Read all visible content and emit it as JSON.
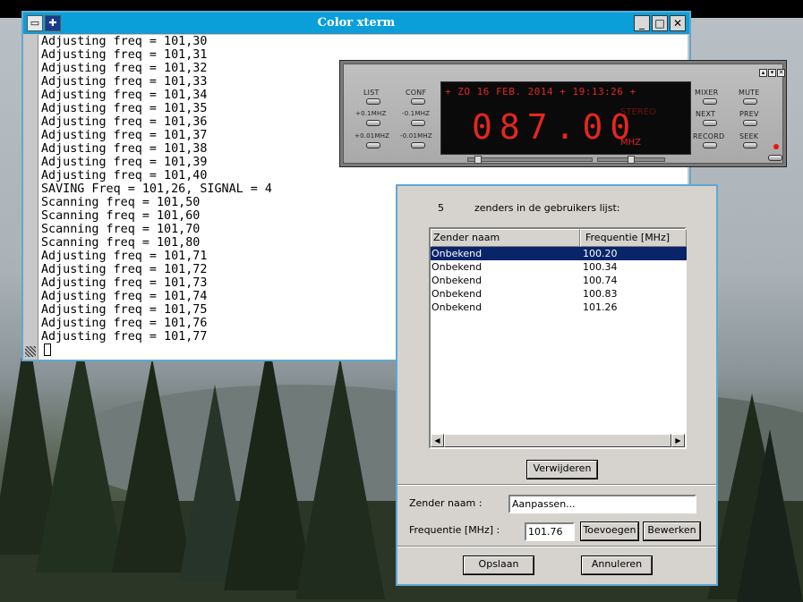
{
  "xterm": {
    "title": "Color xterm",
    "buttons": {
      "minimize": "_",
      "maximize": "□",
      "close": "✕"
    },
    "lines": [
      "Adjusting freq = 101,30",
      "Adjusting freq = 101,31",
      "Adjusting freq = 101,32",
      "Adjusting freq = 101,33",
      "Adjusting freq = 101,34",
      "Adjusting freq = 101,35",
      "Adjusting freq = 101,36",
      "Adjusting freq = 101,37",
      "Adjusting freq = 101,38",
      "Adjusting freq = 101,39",
      "Adjusting freq = 101,40",
      "SAVING Freq = 101,26, SIGNAL = 4",
      "Scanning freq = 101,50",
      "Scanning freq = 101,60",
      "Scanning freq = 101,70",
      "Scanning freq = 101,80",
      "Adjusting freq = 101,71",
      "Adjusting freq = 101,72",
      "Adjusting freq = 101,73",
      "Adjusting freq = 101,74",
      "Adjusting freq = 101,75",
      "Adjusting freq = 101,76",
      "Adjusting freq = 101,77"
    ]
  },
  "radio": {
    "left_labels": {
      "list": "LIST",
      "conf": "CONF",
      "plus01": "+0.1MHZ",
      "minus01": "-0.1MHZ",
      "plus001": "+0.01MHZ",
      "minus001": "-0.01MHZ"
    },
    "right_labels": {
      "mixer": "MIXER",
      "mute": "MUTE",
      "next": "NEXT",
      "prev": "PREV",
      "record": "RECORD",
      "seek": "SEEK"
    },
    "display": {
      "datetime": "+ ZO 16 FEB. 2014 + 19:13:26 +",
      "frequency": "087.00",
      "stereo": "STEREO",
      "mark": "\"",
      "unit": "MHZ"
    },
    "volume_level": 0.05,
    "balance_level": 0.5
  },
  "dialog": {
    "count": "5",
    "count_label": "zenders in de gebruikers lijst:",
    "columns": [
      "Zender naam",
      "Frequentie [MHz]"
    ],
    "stations": [
      {
        "name": "Onbekend",
        "freq": "100.20",
        "selected": true
      },
      {
        "name": "Onbekend",
        "freq": "100.34",
        "selected": false
      },
      {
        "name": "Onbekend",
        "freq": "100.74",
        "selected": false
      },
      {
        "name": "Onbekend",
        "freq": "100.83",
        "selected": false
      },
      {
        "name": "Onbekend",
        "freq": "101.26",
        "selected": false
      }
    ],
    "delete_button": "Verwijderen",
    "name_label": "Zender naam :",
    "name_value": "Aanpassen...",
    "freq_label": "Frequentie [MHz] :",
    "freq_value": "101.76",
    "add_button": "Toevoegen",
    "edit_button": "Bewerken",
    "save_button": "Opslaan",
    "cancel_button": "Annuleren"
  }
}
